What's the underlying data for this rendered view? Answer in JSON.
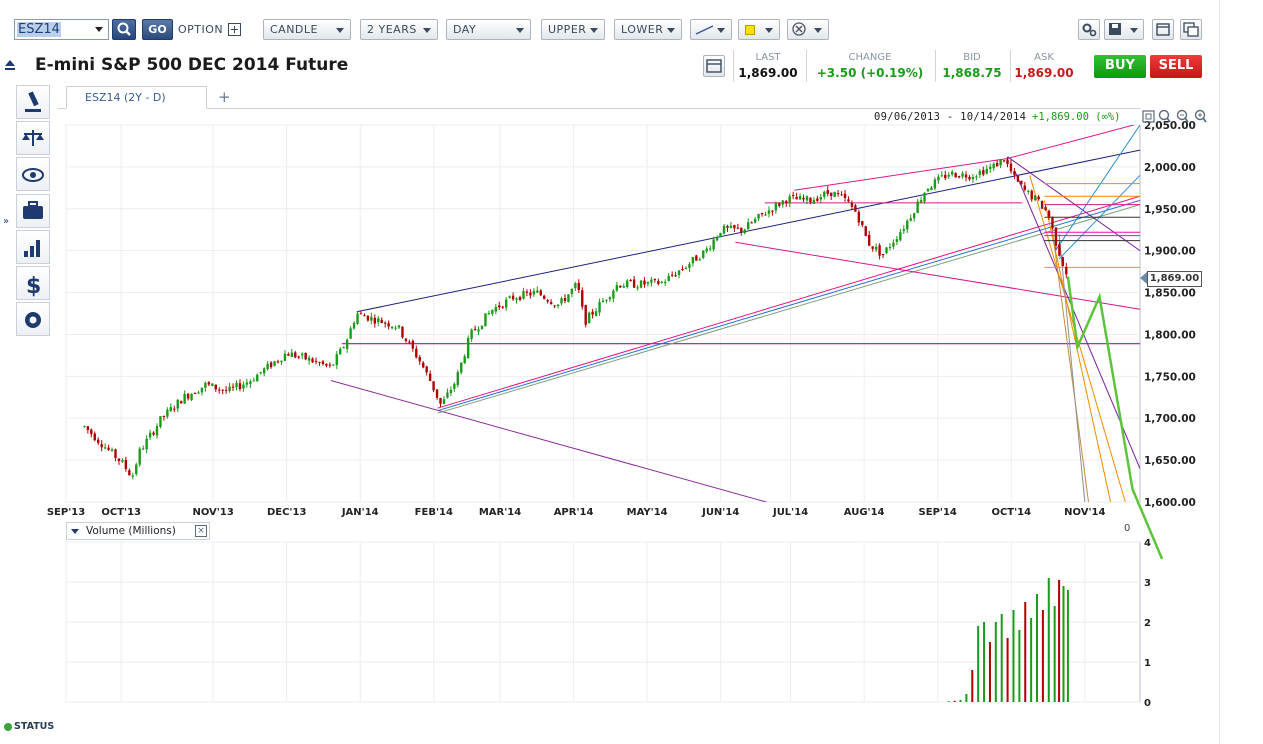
{
  "toolbar": {
    "symbol_value": "ESZ14",
    "go_label": "GO",
    "option_label": "OPTION",
    "chart_type": "CANDLE",
    "period": "2 YEARS",
    "interval": "DAY",
    "upper": "UPPER",
    "lower": "LOWER"
  },
  "header": {
    "title": "E-mini S&P 500 DEC 2014 Future"
  },
  "quote": {
    "last_label": "LAST",
    "last_value": "1,869.00",
    "change_label": "CHANGE",
    "change_value": "+3.50 (+0.19%)",
    "bid_label": "BID",
    "bid_value": "1,868.75",
    "ask_label": "ASK",
    "ask_value": "1,869.00",
    "buy_label": "BUY",
    "sell_label": "SELL"
  },
  "tab": {
    "label": "ESZ14 (2Y - D)",
    "add_label": "+"
  },
  "status_label": "STATUS",
  "colors": {
    "up": "#1a9b1a",
    "down": "#b00000",
    "buy": "#1aa31a",
    "sell": "#d91f1f",
    "accent": "#1f3a6e"
  },
  "chart_data": [
    {
      "type": "candlestick",
      "range_label": "09/06/2013 - 10/14/2014",
      "range_change": "+1,869.00 (∞%)",
      "last_price_label": "1,869.00",
      "ylim": [
        1600,
        2050
      ],
      "y_ticks": [
        "1,600.00",
        "1,650.00",
        "1,700.00",
        "1,750.00",
        "1,800.00",
        "1,850.00",
        "1,900.00",
        "1,950.00",
        "2,000.00",
        "2,050.00"
      ],
      "x_ticks": [
        "SEP'13",
        "OCT'13",
        "NOV'13",
        "DEC'13",
        "JAN'14",
        "FEB'14",
        "MAR'14",
        "APR'14",
        "MAY'14",
        "JUN'14",
        "JUL'14",
        "AUG'14",
        "SEP'14",
        "OCT'14",
        "NOV'14"
      ],
      "x_tick_times": [
        0,
        0.75,
        2.0,
        3.0,
        4.0,
        5.0,
        5.9,
        6.9,
        7.9,
        8.9,
        9.85,
        10.85,
        11.85,
        12.85,
        13.85
      ],
      "price_path": [
        [
          0.25,
          1690
        ],
        [
          0.6,
          1660
        ],
        [
          0.75,
          1648
        ],
        [
          0.9,
          1630
        ],
        [
          1.0,
          1660
        ],
        [
          1.3,
          1700
        ],
        [
          1.6,
          1725
        ],
        [
          1.9,
          1740
        ],
        [
          2.2,
          1732
        ],
        [
          2.5,
          1745
        ],
        [
          2.8,
          1765
        ],
        [
          3.0,
          1778
        ],
        [
          3.3,
          1770
        ],
        [
          3.6,
          1760
        ],
        [
          3.8,
          1790
        ],
        [
          3.95,
          1825
        ],
        [
          4.2,
          1818
        ],
        [
          4.5,
          1810
        ],
        [
          4.8,
          1770
        ],
        [
          4.95,
          1745
        ],
        [
          5.1,
          1715
        ],
        [
          5.3,
          1745
        ],
        [
          5.5,
          1800
        ],
        [
          5.8,
          1830
        ],
        [
          6.1,
          1845
        ],
        [
          6.4,
          1850
        ],
        [
          6.7,
          1835
        ],
        [
          6.95,
          1860
        ],
        [
          7.05,
          1815
        ],
        [
          7.2,
          1830
        ],
        [
          7.5,
          1860
        ],
        [
          7.8,
          1860
        ],
        [
          8.1,
          1862
        ],
        [
          8.4,
          1880
        ],
        [
          8.7,
          1900
        ],
        [
          8.9,
          1925
        ],
        [
          9.2,
          1925
        ],
        [
          9.5,
          1945
        ],
        [
          9.8,
          1962
        ],
        [
          10.1,
          1960
        ],
        [
          10.4,
          1970
        ],
        [
          10.6,
          1960
        ],
        [
          10.75,
          1945
        ],
        [
          10.9,
          1910
        ],
        [
          11.1,
          1895
        ],
        [
          11.4,
          1930
        ],
        [
          11.7,
          1975
        ],
        [
          12.0,
          1992
        ],
        [
          12.3,
          1990
        ],
        [
          12.6,
          2000
        ],
        [
          12.75,
          2010
        ],
        [
          12.9,
          1985
        ],
        [
          13.05,
          1970
        ],
        [
          13.2,
          1960
        ],
        [
          13.35,
          1945
        ],
        [
          13.45,
          1912
        ],
        [
          13.55,
          1885
        ],
        [
          13.62,
          1869
        ]
      ],
      "annotations": {
        "upper_channel": [
          [
            3.95,
            1827
          ],
          [
            14.6,
            2020
          ]
        ],
        "lower_channel": [
          [
            3.6,
            1745
          ],
          [
            9.6,
            1598
          ]
        ],
        "horizontal_1790": [
          [
            3.75,
            1789
          ],
          [
            14.6,
            1789
          ]
        ],
        "green_projection": [
          [
            13.62,
            1869
          ],
          [
            13.75,
            1785
          ],
          [
            14.05,
            1845
          ],
          [
            14.5,
            1615
          ],
          [
            14.9,
            1532
          ]
        ]
      }
    },
    {
      "type": "bar",
      "title": "Volume (Millions)",
      "ylim": [
        0,
        4
      ],
      "y_ticks": [
        "0",
        "1",
        "2",
        "3",
        "4"
      ],
      "corner_label": "0",
      "bars": [
        [
          12.0,
          0.02
        ],
        [
          12.08,
          0.03
        ],
        [
          12.16,
          0.05
        ],
        [
          12.24,
          0.2
        ],
        [
          12.32,
          0.8
        ],
        [
          12.4,
          1.9
        ],
        [
          12.48,
          2.0
        ],
        [
          12.56,
          1.5
        ],
        [
          12.64,
          2.0
        ],
        [
          12.72,
          2.2
        ],
        [
          12.8,
          1.6
        ],
        [
          12.88,
          2.3
        ],
        [
          12.96,
          1.8
        ],
        [
          13.04,
          2.5
        ],
        [
          13.12,
          2.1
        ],
        [
          13.2,
          2.7
        ],
        [
          13.28,
          2.3
        ],
        [
          13.36,
          3.1
        ],
        [
          13.44,
          2.4
        ],
        [
          13.5,
          3.05
        ],
        [
          13.56,
          2.9
        ],
        [
          13.62,
          2.8
        ]
      ]
    }
  ]
}
